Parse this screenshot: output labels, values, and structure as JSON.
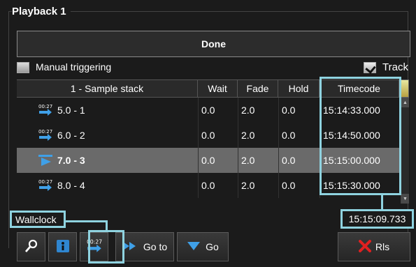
{
  "panel": {
    "title": "Playback 1"
  },
  "status": {
    "text": "Done"
  },
  "options": {
    "manual_triggering": "Manual triggering",
    "manual_checked": false,
    "track": "Track",
    "track_checked": true
  },
  "table": {
    "headers": {
      "name": "1 - Sample stack",
      "wait": "Wait",
      "fade": "Fade",
      "hold": "Hold",
      "timecode": "Timecode"
    },
    "rows": [
      {
        "name": "5.0 - 1",
        "wait": "0.0",
        "fade": "2.0",
        "hold": "0.0",
        "timecode": "15:14:33.000",
        "icon": "wallclock-trigger-icon",
        "selected": false
      },
      {
        "name": "6.0 - 2",
        "wait": "0.0",
        "fade": "2.0",
        "hold": "0.0",
        "timecode": "15:14:50.000",
        "icon": "wallclock-trigger-icon",
        "selected": false
      },
      {
        "name": "7.0 - 3",
        "wait": "0.0",
        "fade": "2.0",
        "hold": "0.0",
        "timecode": "15:15:00.000",
        "icon": "current-cue-play-icon",
        "selected": true
      },
      {
        "name": "8.0 - 4",
        "wait": "0.0",
        "fade": "2.0",
        "hold": "0.0",
        "timecode": "15:15:30.000",
        "icon": "wallclock-trigger-icon",
        "selected": false
      }
    ]
  },
  "footer": {
    "wallclock_label": "Wallclock",
    "clock_value": "15:15:09.733"
  },
  "toolbar": {
    "icons": [
      "magnifier-icon",
      "info-icon",
      "wallclock-trigger-icon"
    ],
    "goto_label": "Go to",
    "go_label": "Go",
    "release_label": "Rls"
  },
  "colors": {
    "highlight": "#8fd3e0",
    "accent_blue": "#3fa0e8",
    "selected_row": "#6a6a6a",
    "release_red": "#e02020"
  }
}
